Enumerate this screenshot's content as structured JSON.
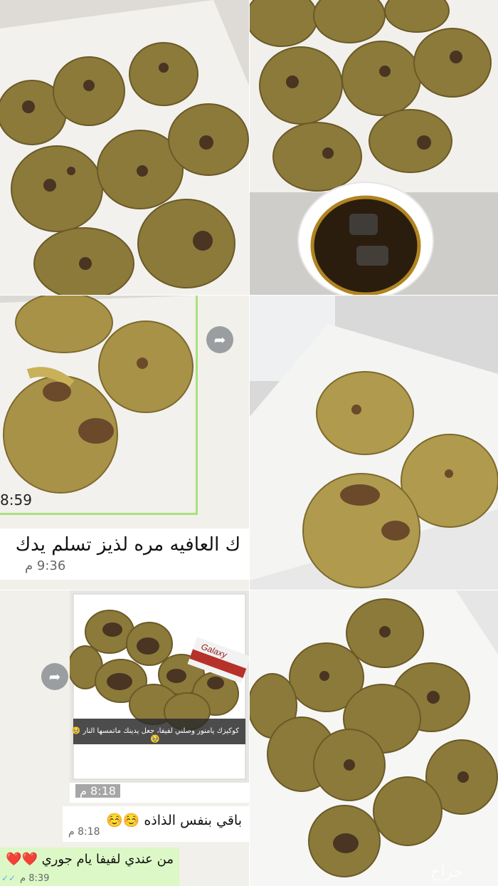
{
  "tiles": {
    "chat_time_1": "8:59",
    "reply_1": {
      "text": "ك العافيه مره لذيز تسلم يدك",
      "time": "9:36 م"
    },
    "forwarded_image": {
      "caption": "كوكيزك يامنور وصلني لفيفا، جعل يدينك ماتمسها النار 🥹",
      "caption_emoji": "🥹",
      "brand_label": "Galaxy",
      "time": "8:18 م"
    },
    "reply_2": {
      "text": "باقي بنفس الذاذه ☺️☺️",
      "time": "8:18 م"
    },
    "reply_3": {
      "text": "من عندي لفيفا يام جوري ❤️❤️",
      "time": "8:39 م",
      "ticks": "✓✓"
    },
    "watermark": "حراج"
  }
}
